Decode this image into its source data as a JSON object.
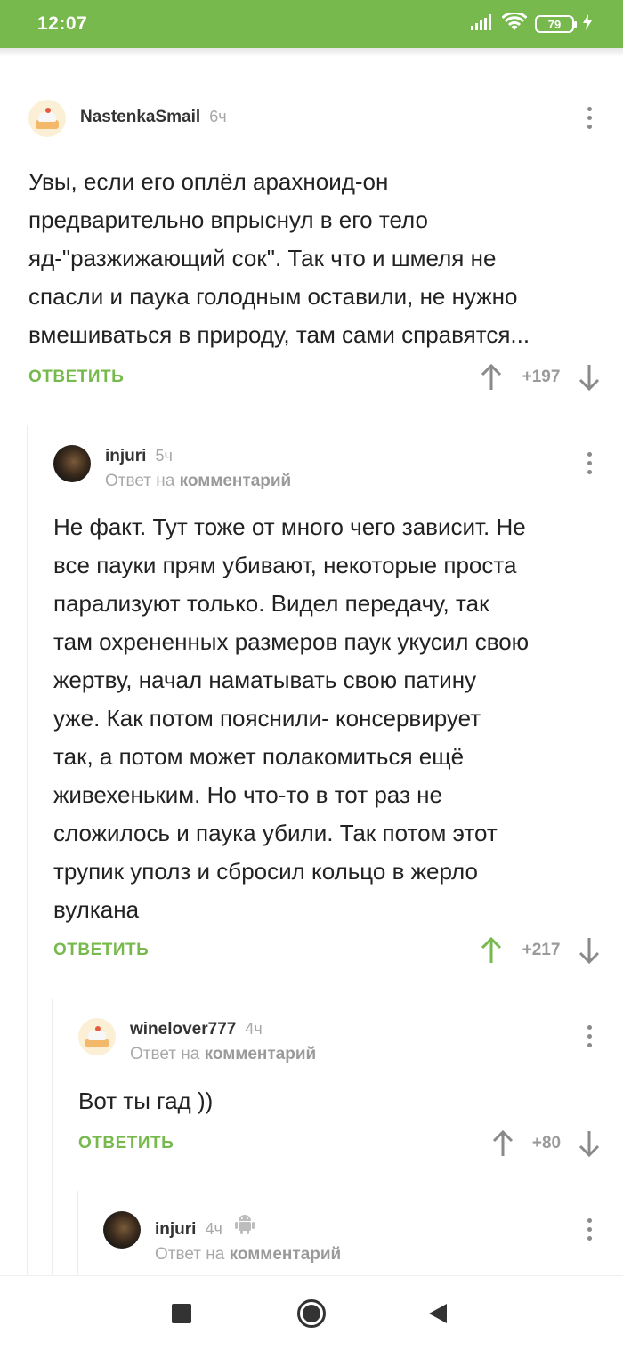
{
  "status_bar": {
    "time": "12:07",
    "battery": "79",
    "color": "#78b94d"
  },
  "comments": [
    {
      "username": "NastenkaSmail",
      "time": "6ч",
      "avatar": "cake-avatar",
      "reply_to": null,
      "text_lines": [
        "Увы, если его оплёл арахноид-он",
        "предварительно впрыснул в его тело",
        "яд-\"разжижающий сок\". Так что и шмеля не",
        "спасли и паука голодным оставили, не нужно",
        "вмешиваться в природу, там сами справятся..."
      ],
      "reply_label": "ОТВЕТИТЬ",
      "score": "+197",
      "upvoted": false
    },
    {
      "username": "injuri",
      "time": "5ч",
      "avatar": "dark-avatar",
      "reply_to_prefix": "Ответ на",
      "reply_to_target": "комментарий",
      "text_lines": [
        "Не факт. Тут тоже от много чего зависит. Не",
        "все пауки прям убивают, некоторые проста",
        "парализуют только. Видел передачу, так",
        "там охрененных размеров паук укусил свою",
        "жертву, начал наматывать свою патину",
        "уже. Как потом пояснили- консервирует",
        "так, а потом может полакомиться ещё",
        "живехеньким. Но что-то в тот раз не",
        "сложилось и паука убили. Так потом этот",
        "трупик уполз и сбросил кольцо в жерло",
        "вулкана"
      ],
      "reply_label": "ОТВЕТИТЬ",
      "score": "+217",
      "upvoted": true
    },
    {
      "username": "winelover777",
      "time": "4ч",
      "avatar": "cake-avatar",
      "reply_to_prefix": "Ответ на",
      "reply_to_target": "комментарий",
      "text_lines": [
        "Вот ты гад ))"
      ],
      "reply_label": "ОТВЕТИТЬ",
      "score": "+80",
      "upvoted": false
    },
    {
      "username": "injuri",
      "time": "4ч",
      "avatar": "dark-avatar",
      "platform_icon": "android-icon",
      "reply_to_prefix": "Ответ на",
      "reply_to_target": "комментарий"
    }
  ],
  "colors": {
    "accent": "#78b94d",
    "upvote_active": "#78b94d",
    "vote_inactive": "#8a8a8a"
  },
  "nav_bar": {
    "icons": [
      "recents-square-icon",
      "home-circle-icon",
      "back-triangle-icon"
    ]
  }
}
